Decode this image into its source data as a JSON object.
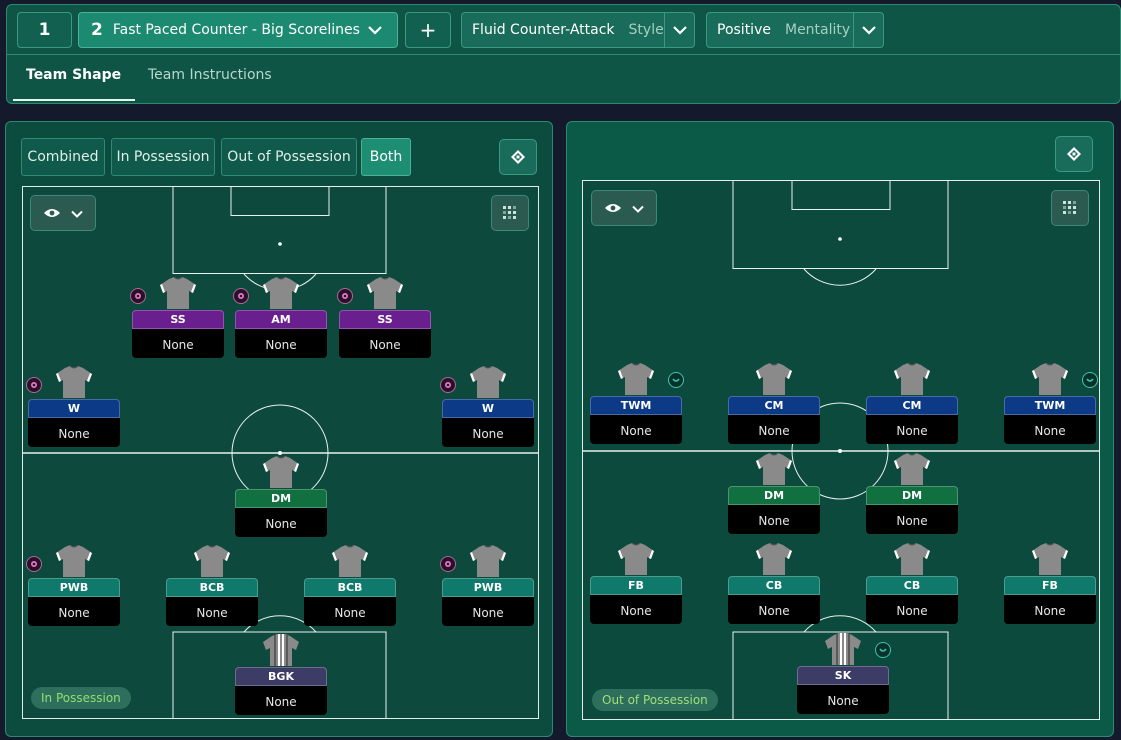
{
  "header": {
    "tactic_1_number": "1",
    "tactic_2_number": "2",
    "tactic_name": "Fast Paced Counter - Big Scorelines",
    "add_label": "+",
    "style_value": "Fluid Counter-Attack",
    "style_label": "Style",
    "mentality_value": "Positive",
    "mentality_label": "Mentality"
  },
  "tabs": [
    {
      "label": "Team Shape",
      "active": true
    },
    {
      "label": "Team Instructions",
      "active": false
    }
  ],
  "modes": [
    {
      "label": "Combined",
      "active": false
    },
    {
      "label": "In Possession",
      "active": false
    },
    {
      "label": "Out of Possession",
      "active": false
    },
    {
      "label": "Both",
      "active": true
    }
  ],
  "left_pitch": {
    "phase_label": "In Possession",
    "players": [
      {
        "role": "SS",
        "duty": "None",
        "type": "att",
        "badge": true
      },
      {
        "role": "AM",
        "duty": "None",
        "type": "att",
        "badge": true
      },
      {
        "role": "SS",
        "duty": "None",
        "type": "att",
        "badge": true
      },
      {
        "role": "W",
        "duty": "None",
        "type": "wing",
        "badge": true
      },
      {
        "role": "W",
        "duty": "None",
        "type": "wing",
        "badge": true
      },
      {
        "role": "DM",
        "duty": "None",
        "type": "dm",
        "badge": false
      },
      {
        "role": "PWB",
        "duty": "None",
        "type": "def",
        "badge": true
      },
      {
        "role": "BCB",
        "duty": "None",
        "type": "def",
        "badge": false
      },
      {
        "role": "BCB",
        "duty": "None",
        "type": "def",
        "badge": false
      },
      {
        "role": "PWB",
        "duty": "None",
        "type": "def",
        "badge": true
      },
      {
        "role": "BGK",
        "duty": "None",
        "type": "gk",
        "badge": false
      }
    ]
  },
  "right_pitch": {
    "phase_label": "Out of Possession",
    "players": [
      {
        "role": "TWM",
        "duty": "None",
        "type": "wing",
        "badge": true
      },
      {
        "role": "CM",
        "duty": "None",
        "type": "wing",
        "badge": false
      },
      {
        "role": "CM",
        "duty": "None",
        "type": "wing",
        "badge": false
      },
      {
        "role": "TWM",
        "duty": "None",
        "type": "wing",
        "badge": true
      },
      {
        "role": "DM",
        "duty": "None",
        "type": "dm",
        "badge": false
      },
      {
        "role": "DM",
        "duty": "None",
        "type": "dm",
        "badge": false
      },
      {
        "role": "FB",
        "duty": "None",
        "type": "def",
        "badge": false
      },
      {
        "role": "CB",
        "duty": "None",
        "type": "def",
        "badge": false
      },
      {
        "role": "CB",
        "duty": "None",
        "type": "def",
        "badge": false
      },
      {
        "role": "FB",
        "duty": "None",
        "type": "def",
        "badge": false
      },
      {
        "role": "SK",
        "duty": "None",
        "type": "gk",
        "badge": true
      }
    ]
  },
  "colors": {
    "accent": "#1d8e72",
    "attack_role": "#6a1f8e",
    "wide_role": "#0c3a86",
    "dm_role": "#117040",
    "defence_role": "#0f7a6c",
    "keeper_role": "#3d3c66"
  },
  "icons": [
    "chevron-down-icon",
    "eye-icon",
    "formation-grid-icon",
    "pitch-view-icon",
    "shirt-icon",
    "instruction-badge-icon"
  ]
}
